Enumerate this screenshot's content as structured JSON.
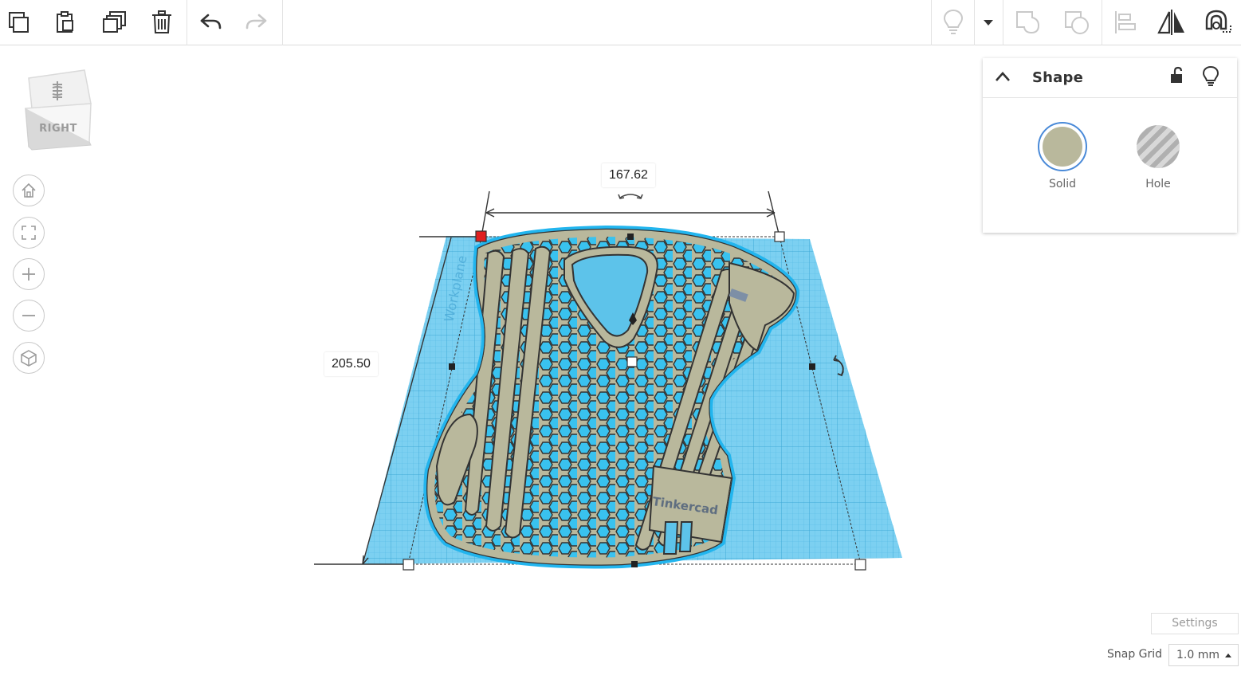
{
  "toolbar": {
    "left_tools": [
      {
        "name": "copy-button",
        "icon": "copy-icon"
      },
      {
        "name": "paste-button",
        "icon": "paste-icon"
      },
      {
        "name": "duplicate-button",
        "icon": "duplicate-icon"
      },
      {
        "name": "delete-button",
        "icon": "trash-icon"
      },
      {
        "name": "undo-button",
        "icon": "undo-icon"
      },
      {
        "name": "redo-button",
        "icon": "redo-icon",
        "disabled": true
      }
    ],
    "right_tools": [
      {
        "name": "light-bulb-button",
        "icon": "light-bulb-icon",
        "disabled": true
      },
      {
        "name": "dropdown-button",
        "icon": "caret-down-icon"
      },
      {
        "name": "group-button",
        "icon": "group-icon",
        "disabled": true
      },
      {
        "name": "ungroup-button",
        "icon": "ungroup-icon",
        "disabled": true
      },
      {
        "name": "align-button",
        "icon": "align-icon",
        "disabled": true
      },
      {
        "name": "mirror-button",
        "icon": "mirror-icon"
      },
      {
        "name": "magnet-button",
        "icon": "magnet-icon"
      }
    ]
  },
  "view_cube": {
    "face_label": "RIGHT"
  },
  "nav": [
    {
      "name": "home-view-button",
      "icon": "home-icon"
    },
    {
      "name": "fit-view-button",
      "icon": "fit-icon"
    },
    {
      "name": "zoom-in-button",
      "icon": "plus-icon"
    },
    {
      "name": "zoom-out-button",
      "icon": "minus-icon"
    },
    {
      "name": "perspective-button",
      "icon": "cube-icon"
    }
  ],
  "workplane": {
    "label": "Workplane"
  },
  "model": {
    "logo_text": "Tinkercad"
  },
  "dimensions": {
    "width": "167.62",
    "depth": "205.50"
  },
  "shape_panel": {
    "title": "Shape",
    "solid_label": "Solid",
    "hole_label": "Hole",
    "solid_color": "#b9b89c"
  },
  "footer": {
    "settings_label": "Settings",
    "snap_grid_label": "Snap Grid",
    "snap_grid_value": "1.0 mm"
  },
  "colors": {
    "workplane": "#5dc3ea",
    "model": "#b9b89c",
    "selection_handle": "#e02020"
  }
}
